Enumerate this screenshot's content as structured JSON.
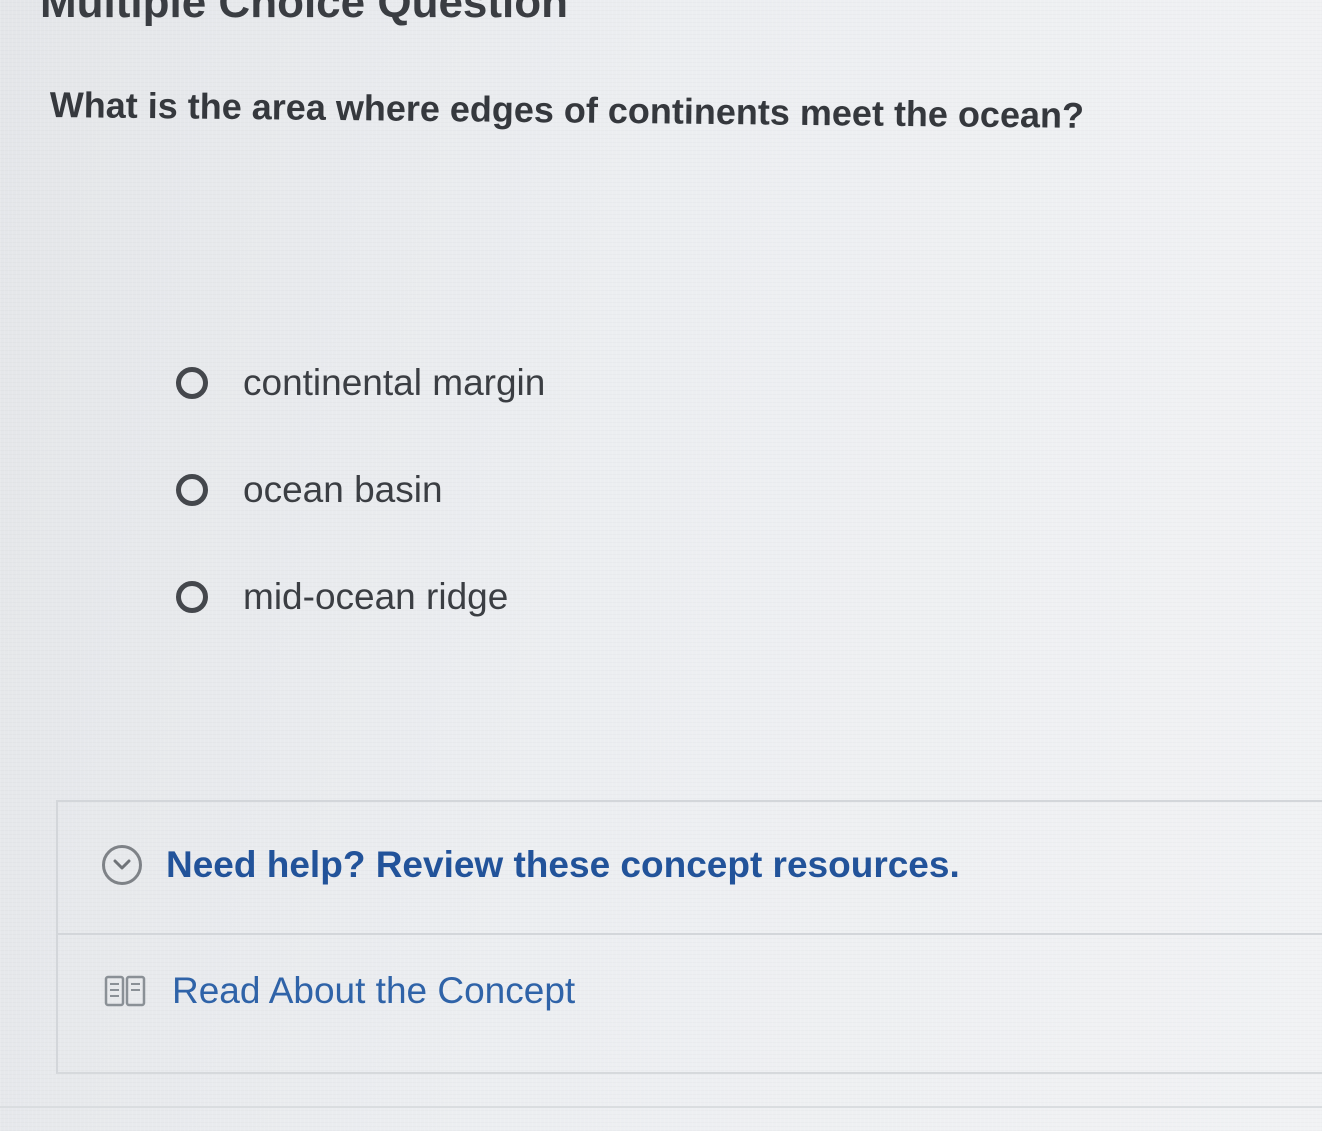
{
  "heading": "Multiple Choice Question",
  "question": "What is the area where edges of continents meet the ocean?",
  "options": [
    {
      "label": "continental margin",
      "selected": false
    },
    {
      "label": "ocean basin",
      "selected": false
    },
    {
      "label": "mid-ocean ridge",
      "selected": false
    }
  ],
  "help": {
    "title": "Need help? Review these concept resources.",
    "toggle_icon": "chevron-down-circle-icon",
    "resources": [
      {
        "label": "Read About the Concept",
        "icon": "book-icon"
      }
    ]
  },
  "colors": {
    "link": "#2f63a8",
    "help_title": "#22539a",
    "text": "#35383d",
    "background": "#eceef1"
  }
}
